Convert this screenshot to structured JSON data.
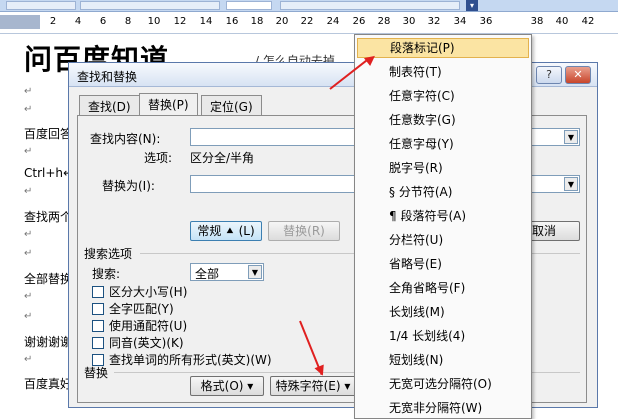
{
  "ruler": {
    "ticks": [
      "2",
      "4",
      "6",
      "8",
      "10",
      "12",
      "14",
      "16",
      "18",
      "20",
      "22",
      "24",
      "26",
      "28",
      "30",
      "32",
      "34",
      "36",
      "38",
      "40",
      "42"
    ]
  },
  "document": {
    "title": "问百度知道",
    "subtitle": "/ 怎么自动去掉",
    "para_mark": "↵",
    "lines": [
      "百度回答",
      "Ctrl+h↵",
      "查找两个",
      "全部替换",
      "谢谢谢谢",
      "百度真好"
    ]
  },
  "dialog": {
    "title": "查找和替换",
    "help": "?",
    "close": "✕",
    "tabs": [
      "查找(D)",
      "替换(P)",
      "定位(G)"
    ],
    "find_label": "查找内容(N):",
    "find_value": "",
    "options_label": "选项:",
    "options_value": "区分全/半角",
    "replace_label": "替换为(I):",
    "replace_value": "",
    "more_button": "常规 ⯅ (L)",
    "replace_button": "替换(R)",
    "cancel_button": "取消",
    "search_options_label": "搜索选项",
    "search_label": "搜索:",
    "search_value": "全部",
    "checkboxes": [
      "区分大小写(H)",
      "全字匹配(Y)",
      "使用通配符(U)",
      "同音(英文)(K)",
      "查找单词的所有形式(英文)(W)"
    ],
    "replace_section": "替换",
    "format_button": "格式(O) ▾",
    "special_button": "特殊字符(E) ▾"
  },
  "menu": {
    "items": [
      "段落标记(P)",
      "制表符(T)",
      "任意字符(C)",
      "任意数字(G)",
      "任意字母(Y)",
      "脱字号(R)",
      "§ 分节符(A)",
      "¶ 段落符号(A)",
      "分栏符(U)",
      "省略号(E)",
      "全角省略号(F)",
      "长划线(M)",
      "1/4 长划线(4)",
      "短划线(N)",
      "无宽可选分隔符(O)",
      "无宽非分隔符(W)"
    ],
    "highlight_color": "#fbe4a3"
  },
  "colors": {
    "annotation_arrow": "#e02020"
  }
}
